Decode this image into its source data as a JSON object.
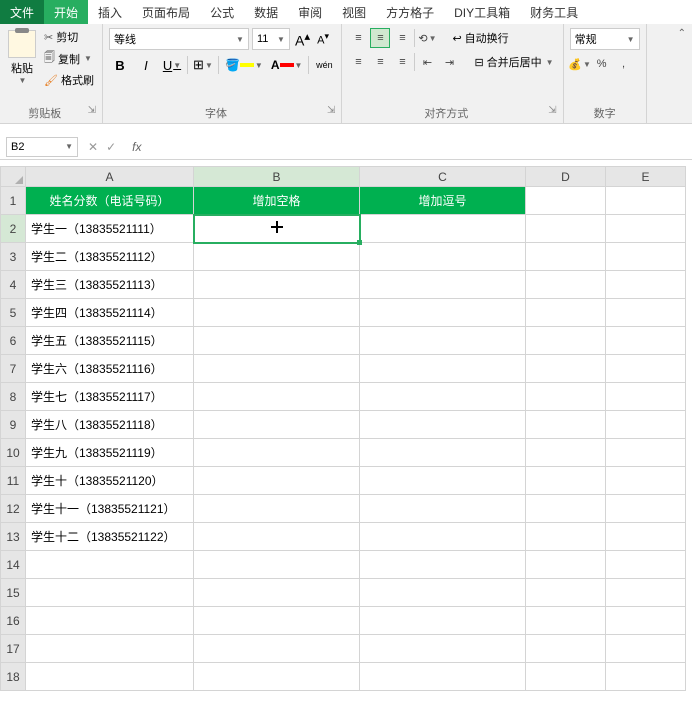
{
  "menubar": {
    "file": "文件",
    "tabs": [
      "开始",
      "插入",
      "页面布局",
      "公式",
      "数据",
      "审阅",
      "视图",
      "方方格子",
      "DIY工具箱",
      "财务工具"
    ],
    "active": 0
  },
  "ribbon": {
    "clipboard": {
      "paste": "粘贴",
      "cut": "剪切",
      "copy": "复制",
      "brush": "格式刷",
      "label": "剪贴板"
    },
    "font": {
      "name": "等线",
      "size": "11",
      "increase": "A",
      "decrease": "A",
      "bold": "B",
      "italic": "I",
      "underline": "U",
      "ruby": "wén",
      "label": "字体"
    },
    "alignment": {
      "wrap": "自动换行",
      "merge": "合并后居中",
      "label": "对齐方式"
    },
    "number": {
      "format": "常规",
      "currency": "%",
      "comma": ",",
      "label": "数字"
    }
  },
  "formula_bar": {
    "name_box": "B2",
    "cancel": "✕",
    "confirm": "✓",
    "fx": "fx",
    "formula": ""
  },
  "grid": {
    "columns": [
      "A",
      "B",
      "C",
      "D",
      "E"
    ],
    "selected_cell": "B2",
    "headers": {
      "a1": "姓名分数（电话号码）",
      "b1": "增加空格",
      "c1": "增加逗号"
    },
    "rows": [
      {
        "n": 1,
        "a": "姓名分数（电话号码）"
      },
      {
        "n": 2,
        "a": "学生一（13835521111）"
      },
      {
        "n": 3,
        "a": "学生二（13835521112）"
      },
      {
        "n": 4,
        "a": "学生三（13835521113）"
      },
      {
        "n": 5,
        "a": "学生四（13835521114）"
      },
      {
        "n": 6,
        "a": "学生五（13835521115）"
      },
      {
        "n": 7,
        "a": "学生六（13835521116）"
      },
      {
        "n": 8,
        "a": "学生七（13835521117）"
      },
      {
        "n": 9,
        "a": "学生八（13835521118）"
      },
      {
        "n": 10,
        "a": "学生九（13835521119）"
      },
      {
        "n": 11,
        "a": "学生十（13835521120）"
      },
      {
        "n": 12,
        "a": "学生十一（13835521121）"
      },
      {
        "n": 13,
        "a": "学生十二（13835521122）"
      },
      {
        "n": 14,
        "a": ""
      },
      {
        "n": 15,
        "a": ""
      },
      {
        "n": 16,
        "a": ""
      },
      {
        "n": 17,
        "a": ""
      },
      {
        "n": 18,
        "a": ""
      }
    ]
  }
}
